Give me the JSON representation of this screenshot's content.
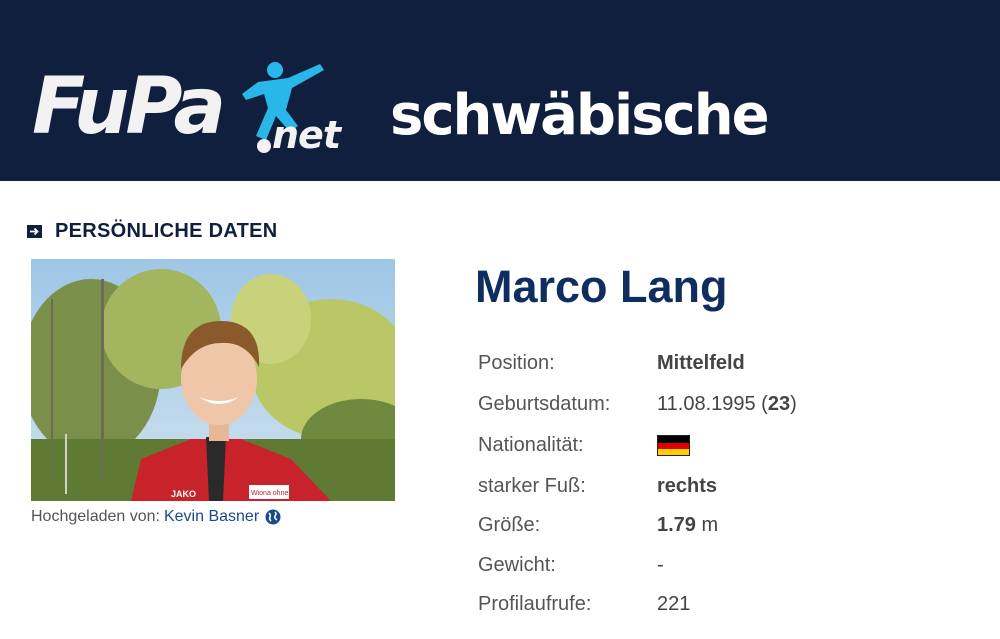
{
  "header": {
    "logo_fupa": "FuPa",
    "logo_net": "net",
    "logo_partner": "schwäbische"
  },
  "section": {
    "title": "PERSÖNLICHE DATEN",
    "icon": "arrow-right-square-icon"
  },
  "photo": {
    "uploaded_by_label": "Hochgeladen von:",
    "uploader_name": "Kevin Basner",
    "uploader_icon": "globe-icon",
    "jersey_brand": "JAKO",
    "jersey_sponsor": "Wiona ohne"
  },
  "player": {
    "name": "Marco Lang"
  },
  "details": {
    "position_label": "Position:",
    "position_value": "Mittelfeld",
    "birth_label": "Geburtsdatum:",
    "birth_date": "11.08.1995",
    "birth_open": " (",
    "birth_age": "23",
    "birth_close": ")",
    "nationality_label": "Nationalität:",
    "nationality_flag": "germany-flag-icon",
    "foot_label": "starker Fuß:",
    "foot_value": "rechts",
    "height_label": "Größe:",
    "height_value": "1.79",
    "height_unit": " m",
    "weight_label": "Gewicht:",
    "weight_value": "-",
    "views_label": "Profilaufrufe:",
    "views_value": "221"
  },
  "colors": {
    "header_bg": "#0f1f3d",
    "accent_blue": "#29b6e8",
    "name_blue": "#0f2d5e",
    "link_blue": "#1a4a8a"
  }
}
